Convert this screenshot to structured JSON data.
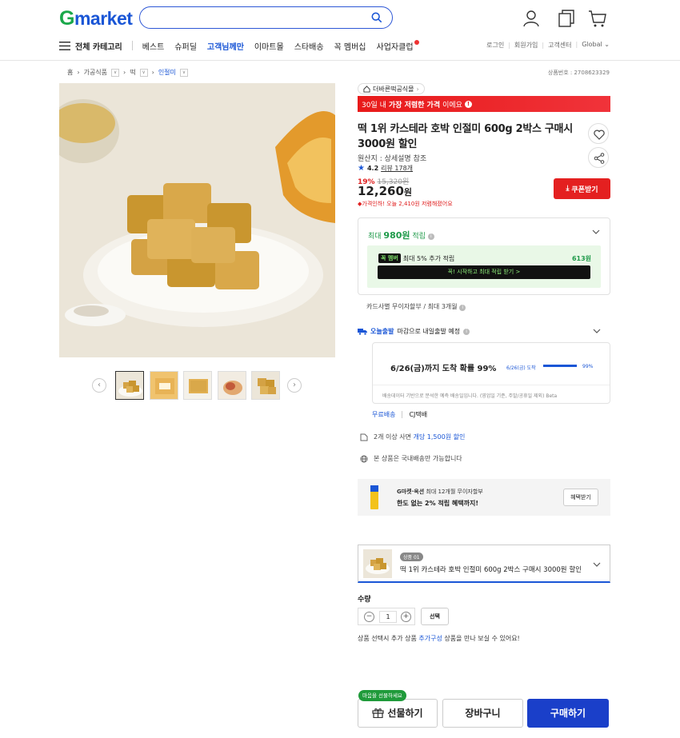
{
  "header": {
    "logo_g": "G",
    "logo_rest": "market",
    "search_placeholder": "",
    "all_categories": "전체 카테고리",
    "nav_items": [
      "베스트",
      "슈퍼딜",
      "고객님께만",
      "이마트몰",
      "스타배송",
      "꼭 멤버십",
      "사업자클럽"
    ],
    "util_links": [
      "로그인",
      "회원가입",
      "고객센터",
      "Global ⌄"
    ]
  },
  "breadcrumb": {
    "items": [
      "홈",
      "가공식품",
      "떡",
      "인절미"
    ],
    "product_no": "상품번호 : 2708623329"
  },
  "product": {
    "store": "더바른떡공식몰",
    "promo_prefix": "30일 내 ",
    "promo_bold": "가장 저렴한 가격",
    "promo_suffix": "이에요",
    "title": "떡 1위 카스테라 호박 인절미 600g 2박스 구매시 3000원 할인",
    "origin": "원산지 : 상세설명 참조",
    "rating": "4.2",
    "review_count": "리뷰 178개",
    "discount_pct": "19%",
    "original_price": "15,320원",
    "price": "12,260",
    "price_unit": "원",
    "lowest_note": "가격인하! 오늘 2,410원 저렴해졌어요",
    "coupon_label": "쿠폰받기"
  },
  "points": {
    "max_prefix": "최대 ",
    "max_amount": "980원",
    "max_suffix": " 적립",
    "member_badge": "꼭 멤버",
    "member_text": "최대 5% 추가 적립",
    "member_amount": "613원",
    "member_cta": "꼭! 시작하고 최대 적립 받기  >",
    "installment": "카드사별 무이자할부 / 최대 3개월"
  },
  "shipping": {
    "tag": "오늘출발",
    "text": "마감으로 내일출발 예정",
    "arrival": "6/26(금)까지 도착 확률 99%",
    "mini_label": "6/26(금) 도착",
    "mini_pct": "99%",
    "mini_fraction": 0.99,
    "note": "배송데이터 기반으로 분석한 예측 배송일입니다. (영업일 기준, 주말/공휴일 제외) Beta",
    "free": "무료배송",
    "carrier": "CJ택배",
    "multi_prefix": "2개 이상 사면 ",
    "multi_highlight": "개당 1,500원 할인",
    "domestic": "본 상품은 국내배송만 가능합니다"
  },
  "card_promo": {
    "line1_bold": "G마켓·옥션",
    "line1_rest": " 최대 12개월 무이자할부",
    "line2": "한도 없는 2% 적립 혜택까지!",
    "button": "혜택받기"
  },
  "option": {
    "badge": "상품 01",
    "title": "떡 1위 카스테라 호박 인절미 600g 2박스 구매시 3000원 할인",
    "qty_label": "수량",
    "qty_value": "1",
    "select_label": "선택",
    "note_prefix": "상품 선택시 추가 상품 ",
    "note_highlight": "추가구성",
    "note_suffix": " 상품을 만나 보실 수 있어요!"
  },
  "actions": {
    "gift_badge": "마음을 선물하세요",
    "gift": "선물하기",
    "cart": "장바구니",
    "buy": "구매하기"
  },
  "colors": {
    "brand_blue": "#1a56d6",
    "brand_green": "#1aa84a",
    "promo_red": "#e81a1a",
    "buy_blue": "#1a3fc9"
  }
}
